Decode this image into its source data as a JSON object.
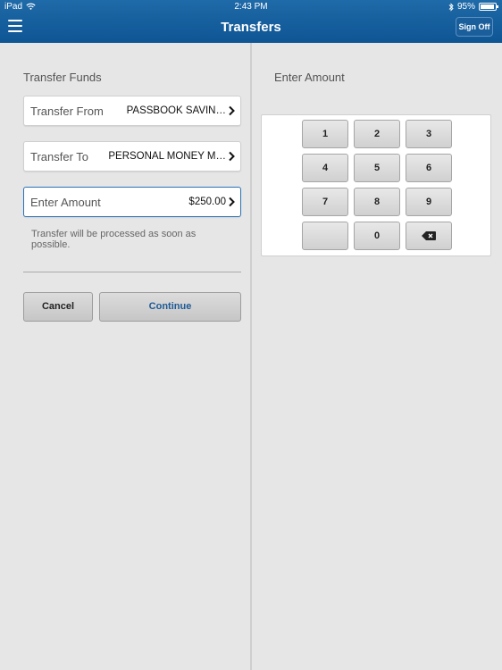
{
  "status_bar": {
    "device": "iPad",
    "time": "2:43 PM",
    "battery": "95%",
    "battery_level": 0.95
  },
  "nav": {
    "title": "Transfers",
    "sign_off_label": "Sign Off"
  },
  "transfer_form": {
    "section_title": "Transfer Funds",
    "from": {
      "label": "Transfer From",
      "value": "PASSBOOK SAVIN…"
    },
    "to": {
      "label": "Transfer To",
      "value": "PERSONAL MONEY M…"
    },
    "amount": {
      "label": "Enter Amount",
      "value": "$250.00"
    },
    "note": "Transfer will be processed as soon as possible.",
    "cancel_label": "Cancel",
    "continue_label": "Continue"
  },
  "keypad": {
    "section_title": "Enter Amount",
    "keys": [
      "1",
      "2",
      "3",
      "4",
      "5",
      "6",
      "7",
      "8",
      "9",
      "",
      "0"
    ],
    "backspace_icon": "backspace-icon"
  },
  "colors": {
    "header": "#0e5594",
    "accent": "#1d5b96",
    "background": "#e6e6e6"
  }
}
